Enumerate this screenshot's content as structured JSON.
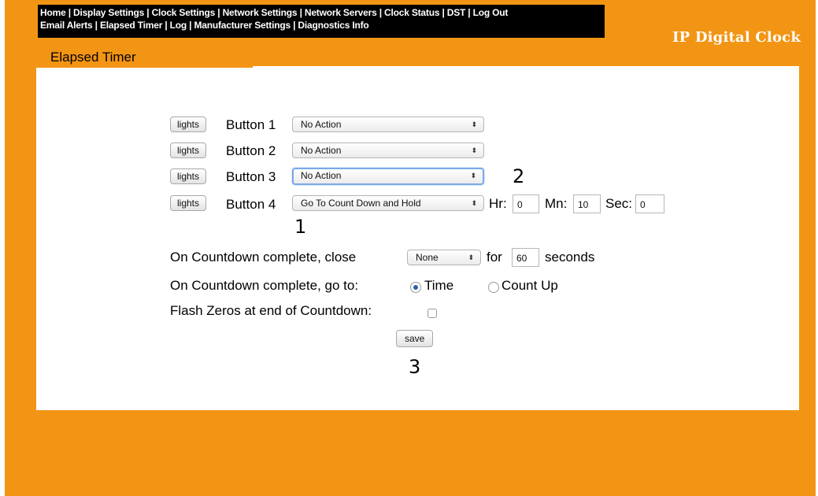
{
  "nav": {
    "row1": [
      "Home",
      "Display Settings",
      "Clock Settings",
      "Network Settings",
      "Network Servers",
      "Clock Status",
      "DST",
      "Log Out"
    ],
    "row2": [
      "Email Alerts",
      "Elapsed Timer",
      "Log",
      "Manufacturer Settings",
      "Diagnostics Info"
    ],
    "separator": "|"
  },
  "brand": "IP Digital Clock",
  "page_title": "Elapsed Timer",
  "buttons": [
    {
      "lights": "lights",
      "label": "Button 1",
      "action": "No Action"
    },
    {
      "lights": "lights",
      "label": "Button 2",
      "action": "No Action"
    },
    {
      "lights": "lights",
      "label": "Button 3",
      "action": "No Action"
    },
    {
      "lights": "lights",
      "label": "Button 4",
      "action": "Go To Count Down and Hold"
    }
  ],
  "countdown_time": {
    "hr_label": "Hr:",
    "hr_value": "0",
    "mn_label": "Mn:",
    "mn_value": "10",
    "sec_label": "Sec:",
    "sec_value": "0"
  },
  "close_row": {
    "label": "On Countdown complete, close",
    "select_value": "None",
    "for_label": "for",
    "seconds_value": "60",
    "seconds_label": "seconds"
  },
  "goto_row": {
    "label": "On Countdown complete, go to:",
    "option_time": "Time",
    "option_countup": "Count Up",
    "selected": "Time"
  },
  "flash_row": {
    "label": "Flash Zeros at end of Countdown:",
    "checked": false
  },
  "save_label": "save",
  "markers": [
    "1",
    "2",
    "3"
  ],
  "colors": {
    "accent": "#f39514",
    "nav_bg": "#000000",
    "content_bg": "#ffffff"
  },
  "icons": {
    "select_arrow": "updown-arrow-icon"
  }
}
